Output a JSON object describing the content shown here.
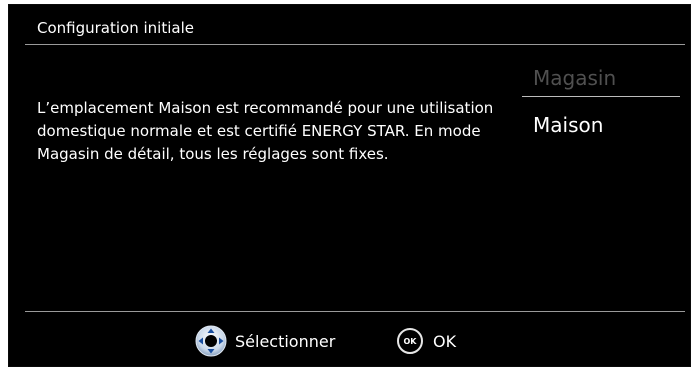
{
  "header": {
    "title": "Configuration initiale"
  },
  "description": "L’emplacement Maison est recommandé pour une utilisation domestique normale et est certifié ENERGY STAR. En mode Magasin de détail, tous les réglages sont fixes.",
  "options": [
    {
      "label": "Magasin",
      "state": "inactive"
    },
    {
      "label": "Maison",
      "state": "selected"
    }
  ],
  "footer": {
    "select_label": "Sélectionner",
    "ok_glyph": "OK",
    "ok_label": "OK"
  },
  "colors": {
    "background": "#000000",
    "text": "#ffffff",
    "inactive_text": "#505050",
    "rule": "#9a9a9a"
  }
}
